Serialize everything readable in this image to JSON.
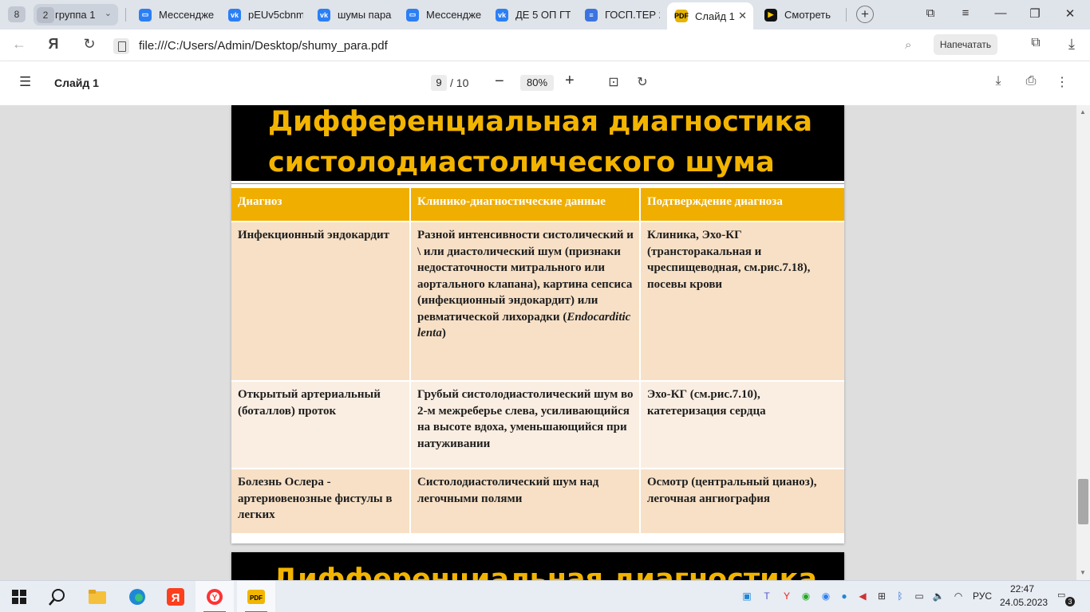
{
  "browser": {
    "tab_groups": {
      "count": "8",
      "group_count": "2",
      "group_name": "группа 1",
      "caret": "⌄"
    },
    "tabs": [
      {
        "label": "Мессендже",
        "icon": "messenger-icon",
        "color": "#2b7ff5"
      },
      {
        "label": "pEUv5cbnm",
        "icon": "vk-icon",
        "color": "#2b7ff5"
      },
      {
        "label": "шумы пара",
        "icon": "vk-icon",
        "color": "#2b7ff5"
      },
      {
        "label": "Мессендже",
        "icon": "messenger-icon",
        "color": "#2b7ff5"
      },
      {
        "label": "ДЕ 5 ОП ГТ",
        "icon": "vk-icon",
        "color": "#2b7ff5"
      },
      {
        "label": "ГОСП.ТЕР 2",
        "icon": "docs-icon",
        "color": "#3b74e0"
      },
      {
        "label": "Слайд 1",
        "icon": "pdf-icon",
        "color": "#e8b400",
        "active": true
      },
      {
        "label": "Смотреть",
        "icon": "video-icon",
        "color": "#111111"
      }
    ],
    "url": "file:///C:/Users/Admin/Desktop/shumy_para.pdf",
    "print_label": "Напечатать"
  },
  "pdf_toolbar": {
    "title": "Слайд 1",
    "current_page": "9",
    "page_total": "/ 10",
    "zoom": "80%"
  },
  "slide": {
    "title_line1": "Дифференциальная диагностика",
    "title_line2": "систолодиастолического шума",
    "headers": [
      "Диагноз",
      "Клинико-диагностические данные",
      "Подтверждение диагноза"
    ],
    "rows": [
      {
        "diagnosis": "Инфекционный эндокардит",
        "clinical": "Разной интенсивности систолический и \\ или диастолический шум (признаки недостаточности митрального или аортального клапана), картина сепсиса (инфекционный эндокардит) или ревматической лихорадки (",
        "clinical_italic": "Endocarditic lenta",
        "clinical_tail": ")",
        "confirmation": "Клиника, Эхо-КГ (трансторакальная и чреспищеводная, см.рис.7.18), посевы крови"
      },
      {
        "diagnosis": "Открытый артериальный (боталлов) проток",
        "clinical": "Грубый систолодиастолический шум во 2-м межреберье слева, усиливающийся на высоте вдоха, уменьшающийся при натуживании",
        "confirmation": "Эхо-КГ (см.рис.7.10), катетеризация сердца"
      },
      {
        "diagnosis": "Болезнь Ослера - артериовенозные фистулы в легких",
        "clinical": "Систолодиастолический шум над легочными полями",
        "confirmation": "Осмотр (центральный цианоз), легочная ангиография"
      }
    ],
    "next_slide_title": "Дифференциальная диагностика"
  },
  "taskbar": {
    "language": "РУС",
    "time": "22:47",
    "date": "24.05.2023",
    "notifications": "3"
  }
}
